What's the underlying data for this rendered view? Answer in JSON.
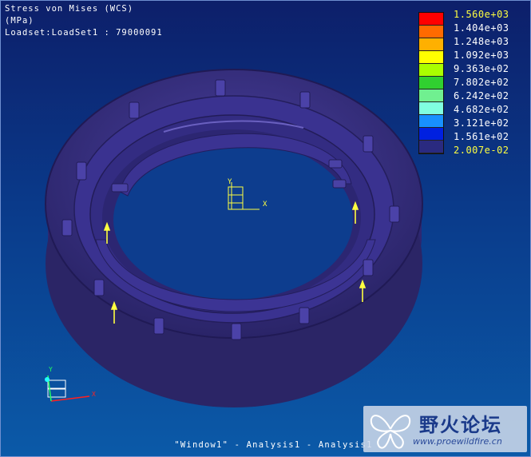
{
  "header": {
    "line1": "Stress von Mises (WCS)",
    "line2": "(MPa)",
    "line3": "Loadset:LoadSet1 :  79000091"
  },
  "legend": {
    "items": [
      {
        "label": "1.560e+03",
        "color": "#ff0000",
        "highlight": true
      },
      {
        "label": "1.404e+03",
        "color": "#ff6a00",
        "highlight": false
      },
      {
        "label": "1.248e+03",
        "color": "#ffb000",
        "highlight": false
      },
      {
        "label": "1.092e+03",
        "color": "#ffff00",
        "highlight": false
      },
      {
        "label": "9.363e+02",
        "color": "#aaff00",
        "highlight": false
      },
      {
        "label": "7.802e+02",
        "color": "#30d030",
        "highlight": false
      },
      {
        "label": "6.242e+02",
        "color": "#70f090",
        "highlight": false
      },
      {
        "label": "4.682e+02",
        "color": "#80ffe0",
        "highlight": false
      },
      {
        "label": "3.121e+02",
        "color": "#1890ff",
        "highlight": false
      },
      {
        "label": "1.561e+02",
        "color": "#0020e0",
        "highlight": false
      },
      {
        "label": "2.007e-02",
        "color": "#2a2a80",
        "highlight": true
      }
    ]
  },
  "axes": {
    "center_x": "X",
    "center_y": "Y",
    "corner_x": "X",
    "corner_y": "Y"
  },
  "footer": {
    "text": "\"Window1\" - Analysis1 - Analysis1"
  },
  "watermark": {
    "title": "野火论坛",
    "url": "www.proewildfire.cn"
  },
  "colors": {
    "part": "#37307a",
    "background_top": "#0d1f6a",
    "background_bottom": "#0b5aa8"
  }
}
